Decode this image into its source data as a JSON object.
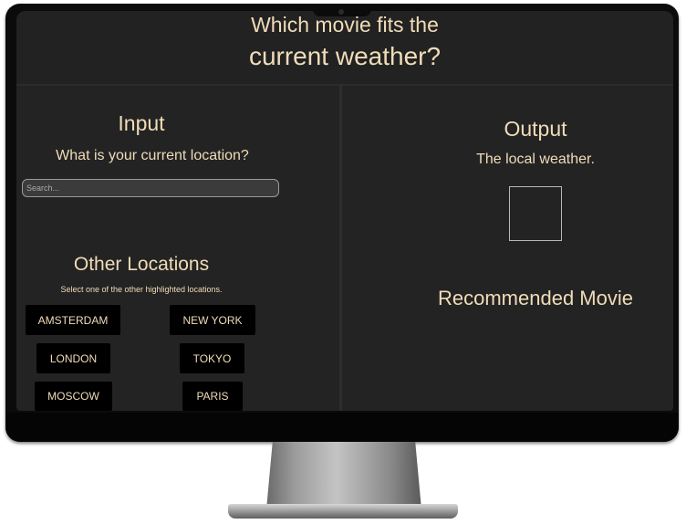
{
  "header": {
    "title_line1": "Which movie fits the",
    "title_line2": "current weather?"
  },
  "input_panel": {
    "heading": "Input",
    "question": "What is your current location?",
    "search_placeholder": "Search..."
  },
  "other_locations": {
    "heading": "Other Locations",
    "hint": "Select one of the other highlighted locations.",
    "buttons": [
      "AMSTERDAM",
      "NEW YORK",
      "LONDON",
      "TOKYO",
      "MOSCOW",
      "PARIS"
    ]
  },
  "output_panel": {
    "heading": "Output",
    "subtitle": "The local weather.",
    "recommended_heading": "Recommended Movie"
  },
  "colors": {
    "accent_text": "#f0dcb8",
    "panel_bg": "#232323",
    "button_bg": "#000000"
  }
}
